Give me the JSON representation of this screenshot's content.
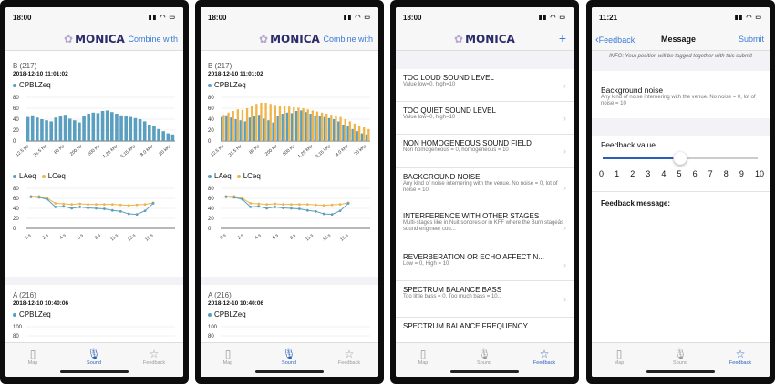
{
  "phones": {
    "p1": {
      "time": "18:00",
      "app": "MONICA",
      "nav_action": "Combine with"
    },
    "p2": {
      "time": "18:00",
      "app": "MONICA",
      "nav_action": "Combine with"
    },
    "p3": {
      "time": "18:00",
      "app": "MONICA",
      "nav_action": "+"
    },
    "p4": {
      "time": "11:21",
      "back": "Feedback",
      "title": "Message",
      "submit": "Submit"
    }
  },
  "sections": {
    "b": {
      "title": "B (217)",
      "date": "2018-12-10 11:01:02"
    },
    "a": {
      "title": "A (216)",
      "date": "2018-12-10 10:40:06"
    }
  },
  "legend": {
    "cpbl": "CPBLZeq",
    "laeq": "LAeq",
    "lceq": "LCeq"
  },
  "colors": {
    "blue": "#5a9fc0",
    "orange": "#f0b449",
    "accent": "#2a5fb8"
  },
  "tabs": {
    "map": "Map",
    "sound": "Sound",
    "feedback": "Feedback"
  },
  "feedback_items": [
    {
      "title": "TOO LOUD SOUND LEVEL",
      "sub": "Value low=0, high=10"
    },
    {
      "title": "TOO QUIET SOUND LEVEL",
      "sub": "Value low=0, high=10"
    },
    {
      "title": "NON HOMOGENEOUS SOUND FIELD",
      "sub": "Non homogeneous = 0, homogeneous = 10"
    },
    {
      "title": "BACKGROUND NOISE",
      "sub": "Any kind of noise internering with the venue. No noise = 0, lot of noise = 10"
    },
    {
      "title": "INTERFERENCE WITH OTHER STAGES",
      "sub": "Multi-stages like in Nuit sonores or in KFF where the Burn stageâs sound engineer cou..."
    },
    {
      "title": "REVERBERATION OR ECHO AFFECTIN...",
      "sub": "Low = 0, High = 10"
    },
    {
      "title": "SPECTRUM BALANCE BASS",
      "sub": "Too little bass = 0, Too much bass = 10..."
    },
    {
      "title": "SPECTRUM BALANCE FREQUENCY",
      "sub": ""
    }
  ],
  "message": {
    "info": "INFO: Your position will be tagged together with this submit",
    "bg_title": "Background noise",
    "bg_sub": "Any kind of noise internering with the venue. No noise = 0, lot of noise = 10",
    "fv_label": "Feedback value",
    "scale": [
      "0",
      "1",
      "2",
      "3",
      "4",
      "5",
      "6",
      "7",
      "8",
      "9",
      "10"
    ],
    "slider_value": 5,
    "fm_label": "Feedback message:"
  },
  "chart_data": [
    {
      "type": "bar",
      "title": "CPBLZeq",
      "categories": [
        "12.5 Hz",
        "31.5 Hz",
        "80 Hz",
        "200 Hz",
        "500 Hz",
        "1.25 kHz",
        "3.15 kHz",
        "8.0 kHz",
        "20 kHz"
      ],
      "ylim": [
        0,
        80
      ],
      "yticks": [
        "0",
        "20",
        "40",
        "60",
        "80"
      ],
      "series": [
        {
          "name": "CPBLZeq",
          "values": [
            44,
            47,
            43,
            40,
            38,
            36,
            43,
            45,
            48,
            41,
            38,
            34,
            46,
            50,
            52,
            51,
            55,
            56,
            53,
            50,
            47,
            45,
            44,
            42,
            40,
            36,
            30,
            27,
            22,
            18,
            14,
            12
          ]
        }
      ]
    },
    {
      "type": "line",
      "x": [
        "0 s",
        "2 s",
        "4 s",
        "6 s",
        "8 s",
        "11 s",
        "13 s",
        "15 s"
      ],
      "ylim": [
        0,
        80
      ],
      "yticks": [
        "0",
        "20",
        "40",
        "60",
        "80"
      ],
      "series": [
        {
          "name": "LAeq",
          "values": [
            63,
            62,
            58,
            43,
            44,
            40,
            43,
            41,
            40,
            39,
            36,
            34,
            29,
            28,
            35,
            50
          ]
        },
        {
          "name": "LCeq",
          "values": [
            64,
            64,
            60,
            50,
            49,
            48,
            49,
            48,
            48,
            48,
            48,
            47,
            46,
            47,
            48,
            51
          ]
        }
      ]
    },
    {
      "type": "bar",
      "title": "CPBLZeq",
      "categories": [
        "12.5 Hz",
        "31.5 Hz",
        "80 Hz",
        "200 Hz",
        "500 Hz",
        "1.25 kHz",
        "3.15 kHz",
        "8.0 kHz",
        "20 kHz"
      ],
      "ylim": [
        0,
        80
      ],
      "yticks": [
        "0",
        "20",
        "40",
        "60",
        "80"
      ],
      "series": [
        {
          "name": "LAeq",
          "values": [
            44,
            47,
            43,
            40,
            38,
            36,
            43,
            45,
            48,
            41,
            38,
            34,
            46,
            50,
            52,
            51,
            55,
            56,
            53,
            50,
            47,
            45,
            44,
            42,
            40,
            36,
            30,
            27,
            22,
            18,
            14,
            12
          ]
        },
        {
          "name": "LCeq",
          "values": [
            48,
            52,
            55,
            58,
            57,
            60,
            65,
            68,
            70,
            70,
            68,
            66,
            65,
            64,
            63,
            62,
            61,
            60,
            58,
            56,
            54,
            52,
            50,
            48,
            46,
            44,
            40,
            36,
            32,
            28,
            25,
            22
          ]
        }
      ]
    },
    {
      "type": "line",
      "x": [
        "0 s",
        "2 s",
        "4 s",
        "6 s",
        "8 s",
        "11 s",
        "13 s",
        "15 s"
      ],
      "ylim": [
        0,
        80
      ],
      "yticks": [
        "0",
        "20",
        "40",
        "60",
        "80"
      ],
      "series": [
        {
          "name": "LAeq",
          "values": [
            63,
            62,
            58,
            43,
            44,
            40,
            43,
            41,
            40,
            39,
            36,
            34,
            29,
            28,
            35,
            50
          ]
        },
        {
          "name": "LCeq",
          "values": [
            64,
            64,
            60,
            50,
            49,
            48,
            49,
            48,
            48,
            48,
            48,
            47,
            46,
            47,
            48,
            51
          ]
        }
      ]
    },
    {
      "type": "bar",
      "title": "CPBLZeq",
      "ylim": [
        0,
        100
      ],
      "yticks": [
        "80",
        "100"
      ]
    }
  ]
}
